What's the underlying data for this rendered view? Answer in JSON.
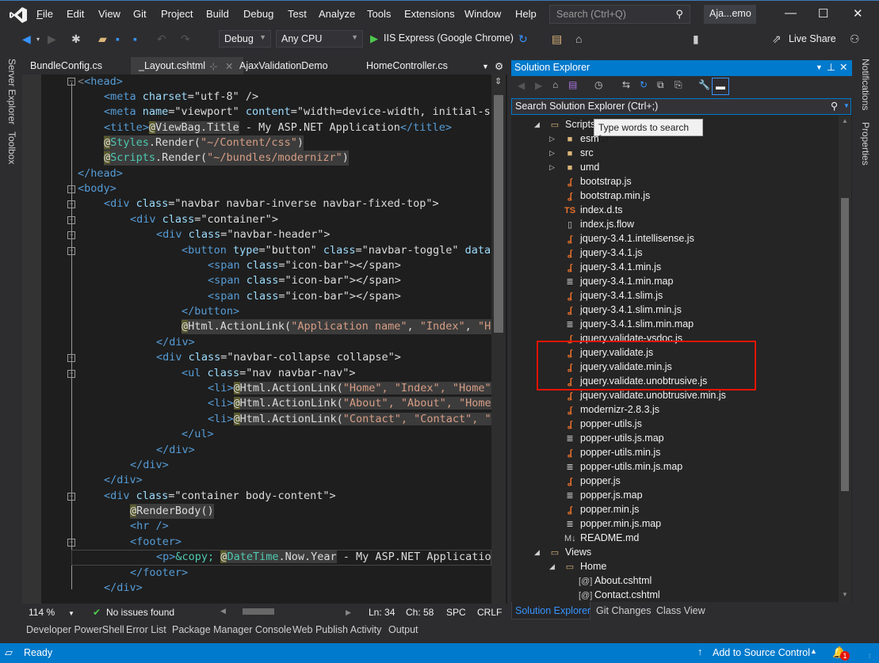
{
  "titlebar": {
    "menus": [
      {
        "label": "File",
        "accel": "F"
      },
      {
        "label": "Edit",
        "accel": "E"
      },
      {
        "label": "View",
        "accel": "V"
      },
      {
        "label": "Git",
        "accel": "G"
      },
      {
        "label": "Project",
        "accel": "P"
      },
      {
        "label": "Build",
        "accel": "B"
      },
      {
        "label": "Debug",
        "accel": "D"
      },
      {
        "label": "Test",
        "accel": "s"
      },
      {
        "label": "Analyze",
        "accel": "n"
      },
      {
        "label": "Tools",
        "accel": "T"
      },
      {
        "label": "Extensions",
        "accel": "x"
      },
      {
        "label": "Window",
        "accel": "W"
      },
      {
        "label": "Help",
        "accel": "H"
      }
    ],
    "search_placeholder": "Search (Ctrl+Q)",
    "solution_name": "Aja...emo",
    "minimize": "—",
    "maximize": "☐",
    "close": "✕"
  },
  "toolbar": {
    "config": "Debug",
    "platform": "Any CPU",
    "run_target": "IIS Express (Google Chrome)",
    "live_share": "Live Share"
  },
  "left_tool_tabs": [
    "Server Explorer",
    "Toolbox"
  ],
  "right_tool_tabs": [
    "Notifications",
    "Properties"
  ],
  "editor": {
    "tabs": [
      {
        "label": "BundleConfig.cs",
        "active": false
      },
      {
        "label": "_Layout.cshtml",
        "active": true
      },
      {
        "label": "AjaxValidationDemo",
        "active": false
      },
      {
        "label": "HomeController.cs",
        "active": false
      }
    ],
    "zoom": "114 %",
    "issues": "No issues found",
    "line": "Ln: 34",
    "col": "Ch: 58",
    "spacing": "SPC",
    "line_ending": "CRLF"
  },
  "code": {
    "l1": "<head>",
    "l2a": "<meta ",
    "l2b": "charset",
    "l2c": "=\"utf-8\" />",
    "l3a": "<meta ",
    "l3b": "name",
    "l3c": "=\"viewport\" ",
    "l3d": "content",
    "l3e": "=\"width=device-width, initial-s",
    "l4a": "<title>",
    "l4b": "@",
    "l4c": "ViewBag.Title",
    "l4d": " - My ASP.NET Application",
    "l4e": "</title>",
    "l5a": "@",
    "l5b": "Styles",
    "l5c": ".Render(",
    "l5d": "\"~/Content/css\"",
    "l5e": ")",
    "l6a": "@",
    "l6b": "Scripts",
    "l6c": ".Render(",
    "l6d": "\"~/bundles/modernizr\"",
    "l6e": ")",
    "l7": "</head>",
    "l8": "<body>",
    "l9a": "<div ",
    "l9b": "class",
    "l9c": "=\"navbar navbar-inverse navbar-fixed-top\">",
    "l10a": "<div ",
    "l10b": "class",
    "l10c": "=\"container\">",
    "l11a": "<div ",
    "l11b": "class",
    "l11c": "=\"navbar-header\">",
    "l12a": "<button ",
    "l12b": "type",
    "l12c": "=\"button\" ",
    "l12d": "class",
    "l12e": "=\"navbar-toggle\" ",
    "l12f": "data",
    "l13a": "<span ",
    "l13b": "class",
    "l13c": "=\"icon-bar\"></span>",
    "l16": "</button>",
    "l17a": "@",
    "l17b": "Html.ActionLink(",
    "l17c": "\"Application name\"",
    "l17d": ", ",
    "l17e": "\"Index\"",
    "l17f": ", ",
    "l17g": "\"H",
    "l18": "</div>",
    "l19a": "<div ",
    "l19b": "class",
    "l19c": "=\"navbar-collapse collapse\">",
    "l20a": "<ul ",
    "l20b": "class",
    "l20c": "=\"nav navbar-nav\">",
    "l21a": "<li>",
    "l21b": "@",
    "l21c": "Html.ActionLink(",
    "l21d": "\"Home\", \"Index\", \"Home\"",
    "l22a": "<li>",
    "l22b": "@",
    "l22c": "Html.ActionLink(",
    "l22d": "\"About\", \"About\", \"Home",
    "l23a": "<li>",
    "l23b": "@",
    "l23c": "Html.ActionLink(",
    "l23d": "\"Contact\", \"Contact\", \"",
    "l24": "</ul>",
    "l25": "</div>",
    "l26": "</div>",
    "l27": "</div>",
    "l28a": "<div ",
    "l28b": "class",
    "l28c": "=\"container body-content\">",
    "l29a": "@",
    "l29b": "RenderBody()",
    "l30": "<hr />",
    "l31": "<footer>",
    "l32a": "<p>",
    "l32b": "&copy; ",
    "l32c": "@",
    "l32d": "DateTime",
    "l32e": ".Now.Year",
    "l32f": " - My ASP.NET Applicatio",
    "l33": "</footer>",
    "l34": "</div>"
  },
  "output_tabs": [
    "Developer PowerShell",
    "Error List",
    "Package Manager Console",
    "Web Publish Activity",
    "Output"
  ],
  "solution_explorer": {
    "title": "Solution Explorer",
    "search_placeholder": "Search Solution Explorer (Ctrl+;)",
    "tooltip": "Type words to search for",
    "tree": [
      {
        "label": "Scripts",
        "type": "folder-open",
        "level": 1,
        "expanded": true
      },
      {
        "label": "esm",
        "type": "folder",
        "level": 2,
        "expanded": false
      },
      {
        "label": "src",
        "type": "folder",
        "level": 2,
        "expanded": false
      },
      {
        "label": "umd",
        "type": "folder",
        "level": 2,
        "expanded": false
      },
      {
        "label": "bootstrap.js",
        "type": "js",
        "level": 2
      },
      {
        "label": "bootstrap.min.js",
        "type": "js",
        "level": 2
      },
      {
        "label": "index.d.ts",
        "type": "ts",
        "level": 2
      },
      {
        "label": "index.js.flow",
        "type": "file",
        "level": 2
      },
      {
        "label": "jquery-3.4.1.intellisense.js",
        "type": "js",
        "level": 2
      },
      {
        "label": "jquery-3.4.1.js",
        "type": "js",
        "level": 2
      },
      {
        "label": "jquery-3.4.1.min.js",
        "type": "js",
        "level": 2
      },
      {
        "label": "jquery-3.4.1.min.map",
        "type": "map",
        "level": 2
      },
      {
        "label": "jquery-3.4.1.slim.js",
        "type": "js",
        "level": 2
      },
      {
        "label": "jquery-3.4.1.slim.min.js",
        "type": "js",
        "level": 2
      },
      {
        "label": "jquery-3.4.1.slim.min.map",
        "type": "map",
        "level": 2
      },
      {
        "label": "jquery.validate-vsdoc.js",
        "type": "js",
        "level": 2
      },
      {
        "label": "jquery.validate.js",
        "type": "js",
        "level": 2,
        "highlighted": true
      },
      {
        "label": "jquery.validate.min.js",
        "type": "js",
        "level": 2,
        "highlighted": true
      },
      {
        "label": "jquery.validate.unobtrusive.js",
        "type": "js",
        "level": 2,
        "highlighted": true
      },
      {
        "label": "jquery.validate.unobtrusive.min.js",
        "type": "js",
        "level": 2
      },
      {
        "label": "modernizr-2.8.3.js",
        "type": "js",
        "level": 2
      },
      {
        "label": "popper-utils.js",
        "type": "js",
        "level": 2
      },
      {
        "label": "popper-utils.js.map",
        "type": "map",
        "level": 2
      },
      {
        "label": "popper-utils.min.js",
        "type": "js",
        "level": 2
      },
      {
        "label": "popper-utils.min.js.map",
        "type": "map",
        "level": 2
      },
      {
        "label": "popper.js",
        "type": "js",
        "level": 2
      },
      {
        "label": "popper.js.map",
        "type": "map",
        "level": 2
      },
      {
        "label": "popper.min.js",
        "type": "js",
        "level": 2
      },
      {
        "label": "popper.min.js.map",
        "type": "map",
        "level": 2
      },
      {
        "label": "README.md",
        "type": "md",
        "level": 2
      },
      {
        "label": "Views",
        "type": "folder-open",
        "level": 1,
        "expanded": true
      },
      {
        "label": "Home",
        "type": "folder-open",
        "level": 2,
        "expanded": true
      },
      {
        "label": "About.cshtml",
        "type": "cshtml",
        "level": 3
      },
      {
        "label": "Contact.cshtml",
        "type": "cshtml",
        "level": 3
      }
    ],
    "bottom_tabs": [
      {
        "label": "Solution Explorer",
        "active": true
      },
      {
        "label": "Git Changes",
        "active": false
      },
      {
        "label": "Class View",
        "active": false
      }
    ],
    "highlight_color": "#e51400"
  },
  "statusbar": {
    "ready": "Ready",
    "source_control": "Add to Source Control",
    "notification_count": "1"
  }
}
